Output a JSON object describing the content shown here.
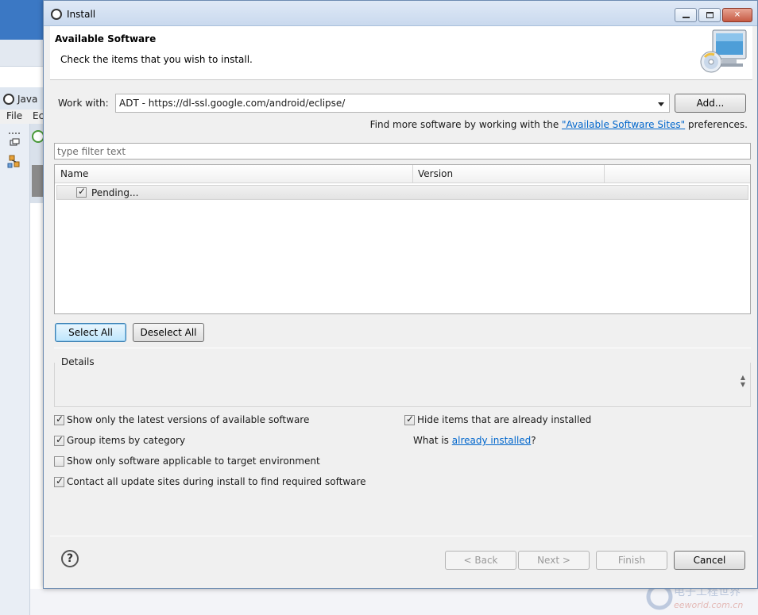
{
  "background": {
    "eclipse_title": "Java",
    "menu": [
      "File",
      "Ec"
    ]
  },
  "dialog": {
    "title": "Install",
    "header_title": "Available Software",
    "header_subtitle": "Check the items that you wish to install.",
    "work_with_label": "Work with:",
    "work_with_value": "ADT - https://dl-ssl.google.com/android/eclipse/",
    "add_button": "Add...",
    "find_more_prefix": "Find more software by working with the ",
    "find_more_link": "\"Available Software Sites\"",
    "find_more_suffix": " preferences.",
    "filter_placeholder": "type filter text",
    "columns": [
      "Name",
      "Version"
    ],
    "rows": [
      {
        "label": "Pending...",
        "checked": true
      }
    ],
    "select_all": "Select All",
    "deselect_all": "Deselect All",
    "details_label": "Details",
    "options_left": [
      {
        "label": "Show only the latest versions of available software",
        "checked": true
      },
      {
        "label": "Group items by category",
        "checked": true
      },
      {
        "label": "Show only software applicable to target environment",
        "checked": false
      },
      {
        "label": "Contact all update sites during install to find required software",
        "checked": true
      }
    ],
    "hide_installed": {
      "label": "Hide items that are already installed",
      "checked": true
    },
    "what_is_prefix": "What is ",
    "what_is_link": "already installed",
    "what_is_suffix": "?",
    "back": "< Back",
    "next": "Next >",
    "finish": "Finish",
    "cancel": "Cancel"
  },
  "icons": {
    "app": "eclipse-icon",
    "header": "computer-cd-icon",
    "help": "help-icon"
  },
  "watermark": {
    "line1": "电子工程世界",
    "line2": "eeworld.com.cn"
  }
}
